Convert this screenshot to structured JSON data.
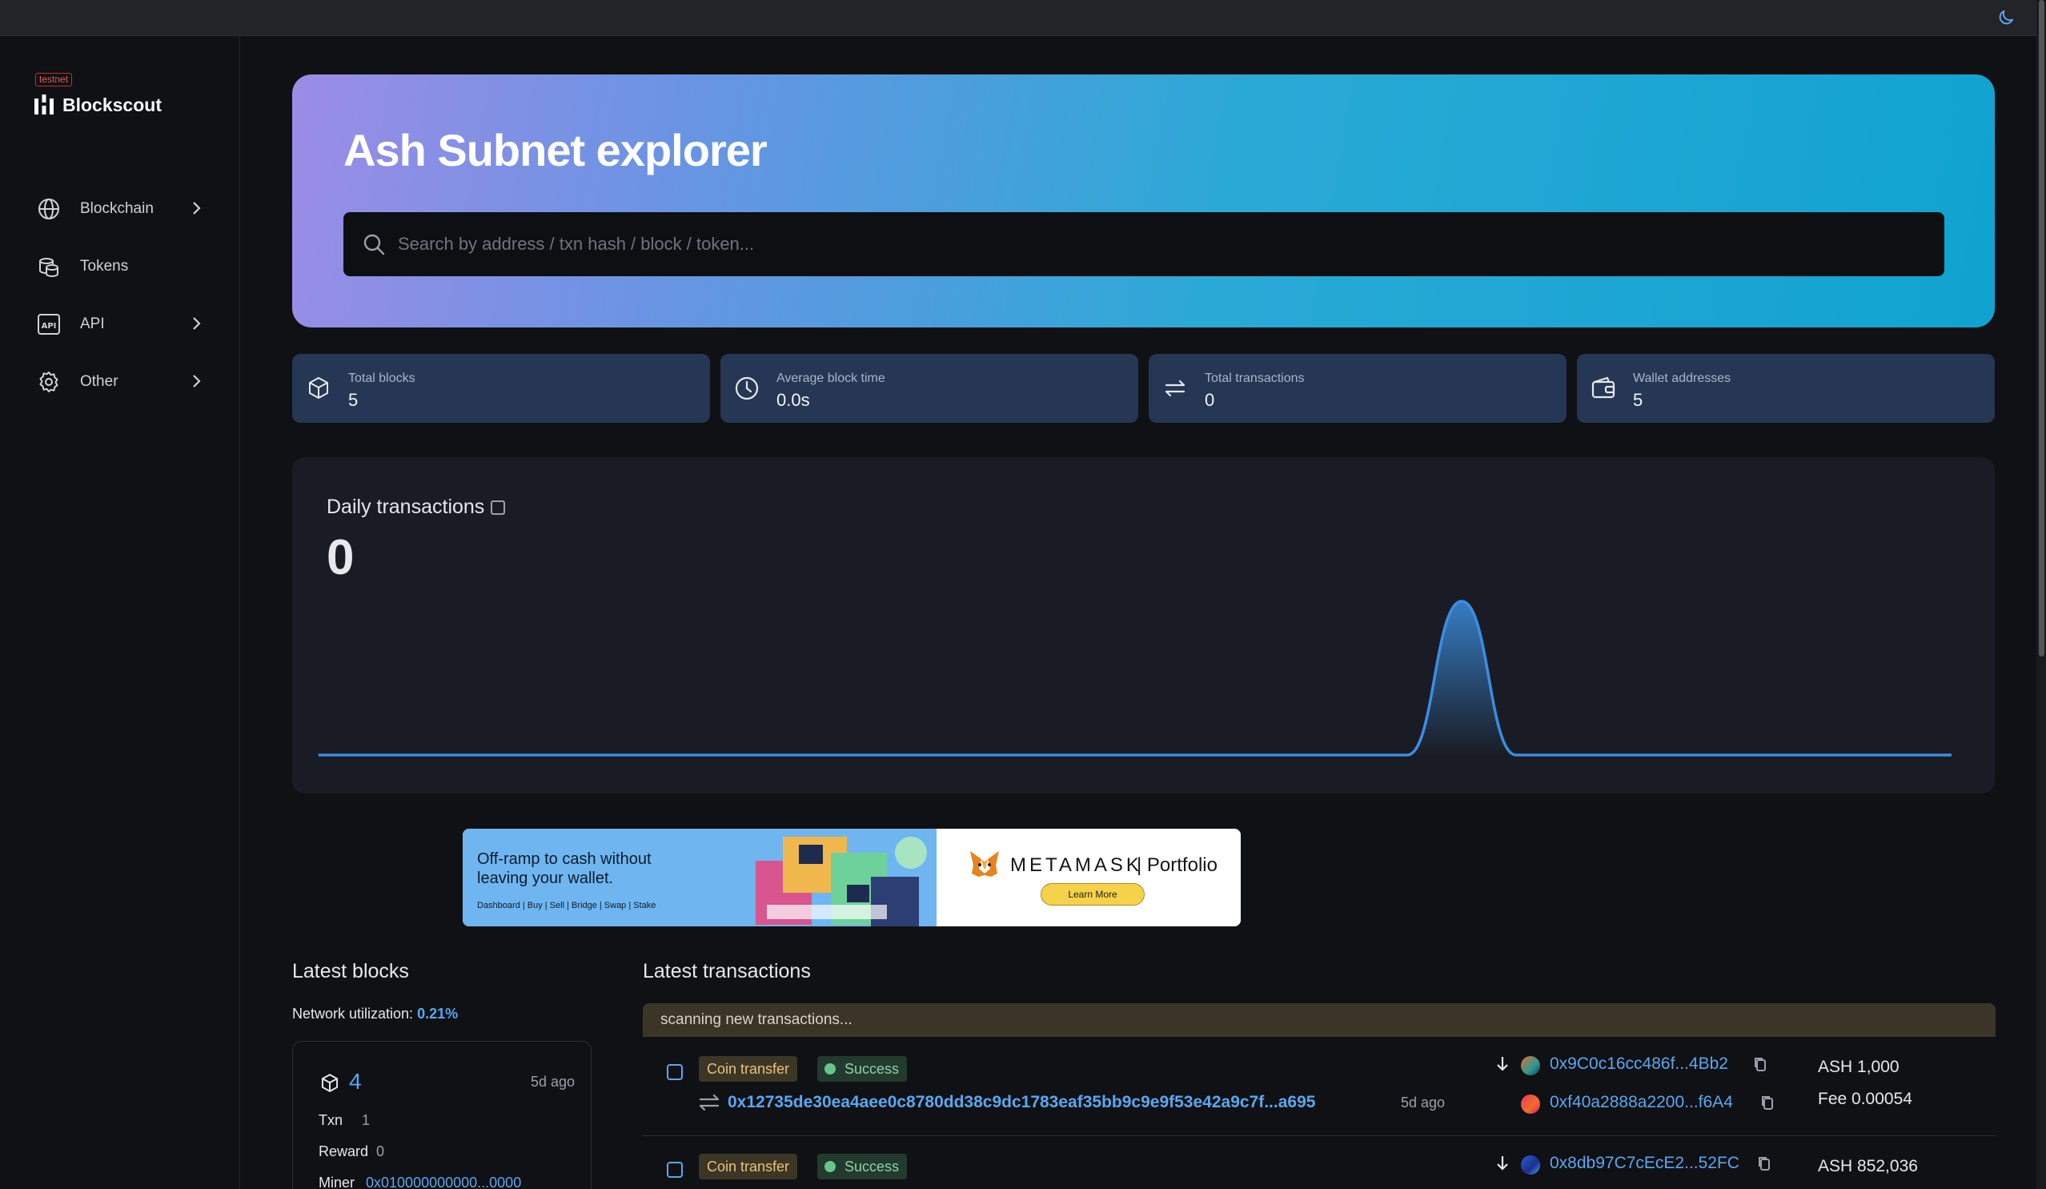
{
  "header": {
    "theme_toggle_icon": "moon-icon"
  },
  "sidebar": {
    "env_badge": "testnet",
    "logo_text": "Blockscout",
    "items": [
      {
        "label": "Blockchain",
        "icon": "globe-icon",
        "has_submenu": true
      },
      {
        "label": "Tokens",
        "icon": "coins-icon",
        "has_submenu": false
      },
      {
        "label": "API",
        "icon": "api-icon",
        "has_submenu": true
      },
      {
        "label": "Other",
        "icon": "gear-icon",
        "has_submenu": true
      }
    ]
  },
  "hero": {
    "title": "Ash Subnet explorer",
    "search_placeholder": "Search by address / txn hash / block / token..."
  },
  "stats": [
    {
      "label": "Total blocks",
      "value": "5",
      "icon": "cube-icon"
    },
    {
      "label": "Average block time",
      "value": "0.0s",
      "icon": "clock-icon"
    },
    {
      "label": "Total transactions",
      "value": "0",
      "icon": "arrows-icon"
    },
    {
      "label": "Wallet addresses",
      "value": "5",
      "icon": "wallet-icon"
    }
  ],
  "daily_chart": {
    "title": "Daily transactions",
    "value": "0",
    "line_color": "#3a8ee0"
  },
  "chart_data": {
    "type": "area",
    "title": "Daily transactions",
    "x": [
      0,
      1,
      2,
      3,
      4,
      5,
      6,
      7,
      8,
      9,
      10,
      11,
      12,
      13,
      14,
      15,
      16,
      17,
      18,
      19,
      20,
      21,
      22,
      23,
      24,
      25,
      26,
      27,
      28,
      29,
      30
    ],
    "values": [
      0,
      0,
      0,
      0,
      0,
      0,
      0,
      0,
      0,
      0,
      0,
      0,
      0,
      0,
      0,
      0,
      0,
      0,
      0,
      0,
      0,
      1,
      0,
      0,
      0,
      0,
      0,
      0,
      0,
      0,
      0
    ],
    "xlabel": "",
    "ylabel": "",
    "grid": false
  },
  "ad": {
    "headline": "Off-ramp to cash without leaving your wallet.",
    "links": "Dashboard  |  Buy  |  Sell  |  Bridge  |  Swap  |  Stake",
    "brand": "METAMASK",
    "product": "Portfolio",
    "cta": "Learn More"
  },
  "latest_blocks": {
    "title": "Latest blocks",
    "util_label": "Network utilization:",
    "util_value": "0.21%",
    "block": {
      "number": "4",
      "age": "5d ago",
      "txn_label": "Txn",
      "txn_value": "1",
      "reward_label": "Reward",
      "reward_value": "0",
      "miner_label": "Miner",
      "miner_value": "0x010000000000...0000"
    }
  },
  "latest_transactions": {
    "title": "Latest transactions",
    "scanning": "scanning new transactions...",
    "rows": [
      {
        "type": "Coin transfer",
        "status": "Success",
        "hash": "0x12735de30ea4aee0c8780dd38c9dc1783eaf35bb9c9e9f53e42a9c7f...a695",
        "age": "5d ago",
        "from": "0x9C0c16cc486f...4Bb2",
        "to": "0xf40a2888a2200...f6A4",
        "value": "ASH 1,000",
        "fee": "Fee 0.00054"
      },
      {
        "type": "Coin transfer",
        "status": "Success",
        "from": "0x8db97C7cEcE2...52FC",
        "value": "ASH 852,036"
      }
    ]
  }
}
